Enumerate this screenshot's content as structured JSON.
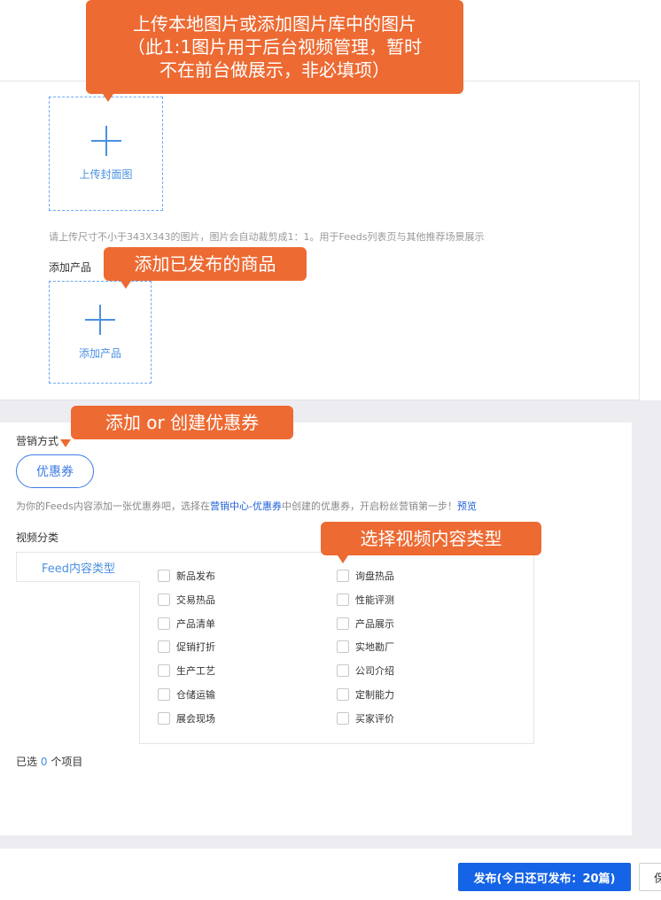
{
  "upload_cover": {
    "label": "上传封面图",
    "hint": "请上传尺寸不小于343X343的图片，图片会自动裁剪成1：1。用于Feeds列表页与其他推荐场景展示"
  },
  "add_product": {
    "section_label": "添加产品",
    "box_label": "添加产品"
  },
  "marketing": {
    "section_label": "营销方式",
    "coupon_button": "优惠券",
    "desc_prefix": "为你的Feeds内容添加一张优惠券吧，选择在",
    "desc_link": "营销中心-优惠券",
    "desc_middle": "中创建的优惠券，开启粉丝营销第一步！",
    "preview_link": "预览"
  },
  "video_category": {
    "section_label": "视频分类",
    "tab_label": "Feed内容类型",
    "left_options": [
      "新品发布",
      "交易热品",
      "产品清单",
      "促销打折",
      "生产工艺",
      "仓储运输",
      "展会现场"
    ],
    "right_options": [
      "询盘热品",
      "性能评测",
      "产品展示",
      "实地勘厂",
      "公司介绍",
      "定制能力",
      "买家评价"
    ],
    "selected_prefix": "已选",
    "selected_count": "0",
    "selected_suffix": "个项目"
  },
  "footer": {
    "publish_button": "发布(今日还可发布：20篇)",
    "save_button": "保"
  },
  "callouts": {
    "cover_line1": "上传本地图片或添加图片库中的图片",
    "cover_line2": "（此1:1图片用于后台视频管理，暂时",
    "cover_line3": "不在前台做展示，非必填项）",
    "product": "添加已发布的商品",
    "coupon": "添加 or 创建优惠券",
    "category": "选择视频内容类型"
  },
  "colors": {
    "accent_blue": "#1563e6",
    "callout_orange": "#ed6a33",
    "upload_blue": "#4a90e2"
  },
  "icons": [
    "plus-icon",
    "checkbox-icon"
  ]
}
